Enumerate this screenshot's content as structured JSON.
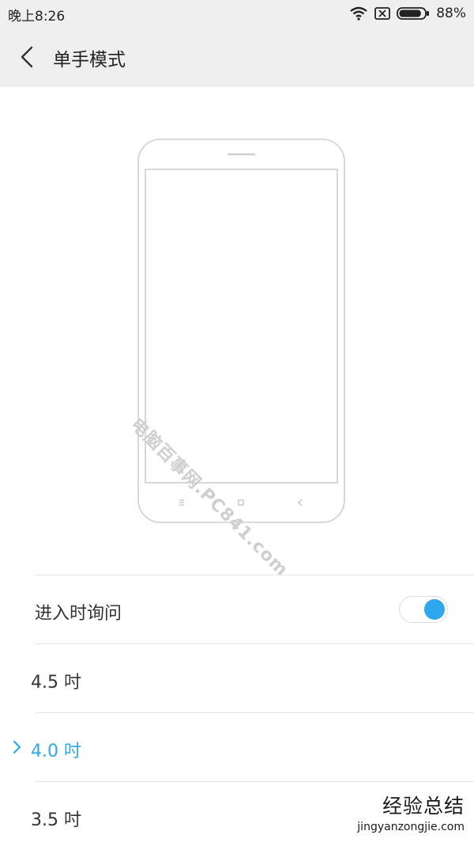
{
  "status_bar": {
    "time": "晚上8:26",
    "battery_percent": "88%",
    "battery_level": 0.88
  },
  "header": {
    "title": "单手模式"
  },
  "illustration": {
    "watermark": "电脑百事网.PC841.com"
  },
  "settings": {
    "ask_on_enter_label": "进入时询问",
    "ask_on_enter_enabled": true,
    "accent_color": "#2fa7ee",
    "sizes": [
      {
        "label": "4.5 吋",
        "selected": false
      },
      {
        "label": "4.0 吋",
        "selected": true
      },
      {
        "label": "3.5 吋",
        "selected": false
      }
    ]
  },
  "footer_brand": {
    "name": "经验总结",
    "url": "jingyanzongjie.com"
  }
}
